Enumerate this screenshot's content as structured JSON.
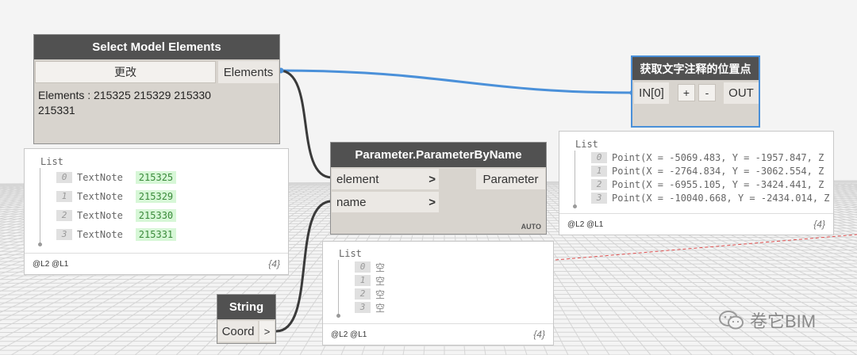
{
  "nodes": {
    "select": {
      "title": "Select Model Elements",
      "change_button": "更改",
      "output_port": "Elements",
      "text_line1": "Elements : 215325 215329 215330",
      "text_line2": "215331"
    },
    "param": {
      "title": "Parameter.ParameterByName",
      "input1": "element",
      "input2": "name",
      "arrow": ">",
      "output": "Parameter",
      "lacing": "AUTO"
    },
    "custom": {
      "title": "获取文字注释的位置点",
      "input": "IN[0]",
      "add": "+",
      "remove": "-",
      "output": "OUT"
    },
    "string": {
      "title": "String",
      "value": "Coord",
      "output_arrow": ">"
    }
  },
  "watches": {
    "left": {
      "header": "List",
      "items": [
        {
          "idx": "0",
          "type": "TextNote",
          "value": "215325"
        },
        {
          "idx": "1",
          "type": "TextNote",
          "value": "215329"
        },
        {
          "idx": "2",
          "type": "TextNote",
          "value": "215330"
        },
        {
          "idx": "3",
          "type": "TextNote",
          "value": "215331"
        }
      ],
      "levels": "@L2 @L1",
      "count": "{4}"
    },
    "middle": {
      "header": "List",
      "items": [
        {
          "idx": "0",
          "value": "空"
        },
        {
          "idx": "1",
          "value": "空"
        },
        {
          "idx": "2",
          "value": "空"
        },
        {
          "idx": "3",
          "value": "空"
        }
      ],
      "levels": "@L2 @L1",
      "count": "{4}"
    },
    "right": {
      "header": "List",
      "items": [
        {
          "idx": "0",
          "value": "Point(X = -5069.483, Y = -1957.847, Z"
        },
        {
          "idx": "1",
          "value": "Point(X = -2764.834, Y = -3062.554, Z"
        },
        {
          "idx": "2",
          "value": "Point(X = -6955.105, Y = -3424.441, Z"
        },
        {
          "idx": "3",
          "value": "Point(X = -10040.668, Y = -2434.014, Z"
        }
      ],
      "levels": "@L2 @L1",
      "count": "{4}"
    }
  },
  "watermark": {
    "text": "卷它BIM",
    "icon": "wechat-icon"
  },
  "colors": {
    "node_header": "#515151",
    "node_body": "#d8d4ce",
    "selected_border": "#4a90d9",
    "wire_selected": "#4a90d9",
    "wire_default": "#3a3a3a",
    "value_highlight": "#d7f7d7"
  }
}
